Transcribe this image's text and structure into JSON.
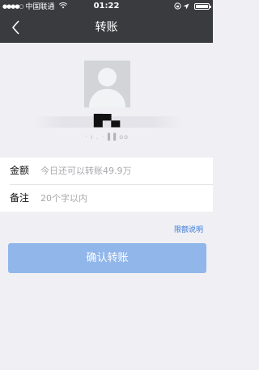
{
  "status_bar": {
    "signal": "●●●●○",
    "carrier": "中国联通",
    "wifi_icon": "wifi-icon",
    "time": "01:22",
    "lock_icon": "rotation-lock-icon",
    "location_icon": "location-arrow-icon",
    "battery_icon": "battery-full-icon"
  },
  "nav": {
    "title": "转账",
    "back_icon": "chevron-left-icon"
  },
  "recipient": {
    "avatar_icon": "default-avatar-icon",
    "name": "█▀▄",
    "account": "· ı . · ▌▌oo"
  },
  "form": {
    "amount_label": "金额",
    "amount_placeholder": "今日还可以转账49.9万",
    "note_label": "备注",
    "note_placeholder": "20个字以内"
  },
  "limit_link": "限额说明",
  "confirm_button": "确认转账",
  "colors": {
    "topbar": "#3a3b3f",
    "background": "#efeff4",
    "button": "#91b6ea",
    "link": "#3b7bd9"
  }
}
